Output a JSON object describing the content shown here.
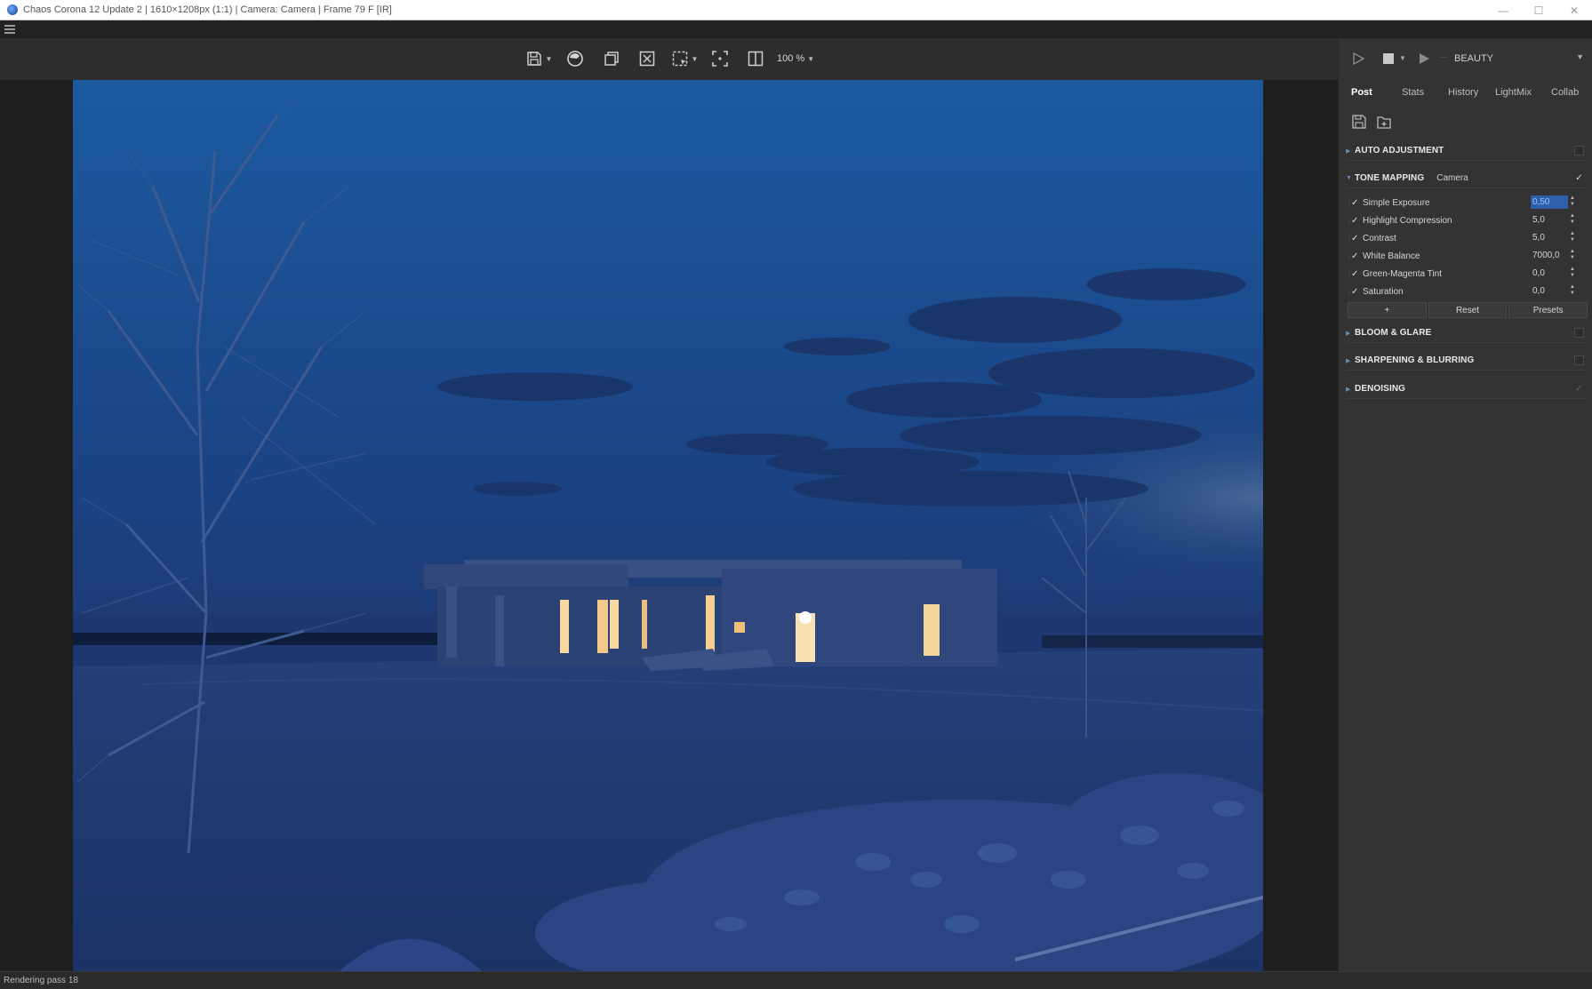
{
  "window": {
    "title": "Chaos Corona 12 Update 2 | 1610×1208px (1:1) | Camera: Camera | Frame 79 F [IR]",
    "minimize": "—",
    "maximize": "☐",
    "close": "✕"
  },
  "toolbar": {
    "zoom": "100 %",
    "icons": [
      "save-icon",
      "render-sphere-icon",
      "copy-icon",
      "clear-icon",
      "region-select-icon",
      "focus-region-icon",
      "split-compare-icon"
    ]
  },
  "render_controls": {
    "pass": "BEAUTY"
  },
  "tabs": [
    "Post",
    "Stats",
    "History",
    "LightMix",
    "Collab"
  ],
  "active_tab": "Post",
  "sections": {
    "auto_adjustment": "AUTO ADJUSTMENT",
    "tone_mapping": "TONE MAPPING",
    "tone_mapping_preset": "Camera",
    "bloom_glare": "BLOOM & GLARE",
    "sharpening": "SHARPENING & BLURRING",
    "denoising": "DENOISING"
  },
  "tone_params": [
    {
      "label": "Simple Exposure",
      "value": "0,50",
      "checked": "✓"
    },
    {
      "label": "Highlight Compression",
      "value": "5,0",
      "checked": "✓"
    },
    {
      "label": "Contrast",
      "value": "5,0",
      "checked": "✓"
    },
    {
      "label": "White Balance",
      "value": "7000,0",
      "checked": "✓"
    },
    {
      "label": "Green-Magenta Tint",
      "value": "0,0",
      "checked": "✓"
    },
    {
      "label": "Saturation",
      "value": "0,0",
      "checked": "✓"
    }
  ],
  "buttons": {
    "add": "+",
    "reset": "Reset",
    "presets": "Presets"
  },
  "status": "Rendering pass 18",
  "colors": {
    "sky_top": "#1b4f93",
    "sky_mid": "#1d3f7a",
    "ground": "#213a6e",
    "window_light": "#f6d9a2",
    "accent_selection": "#2f5fa8"
  }
}
